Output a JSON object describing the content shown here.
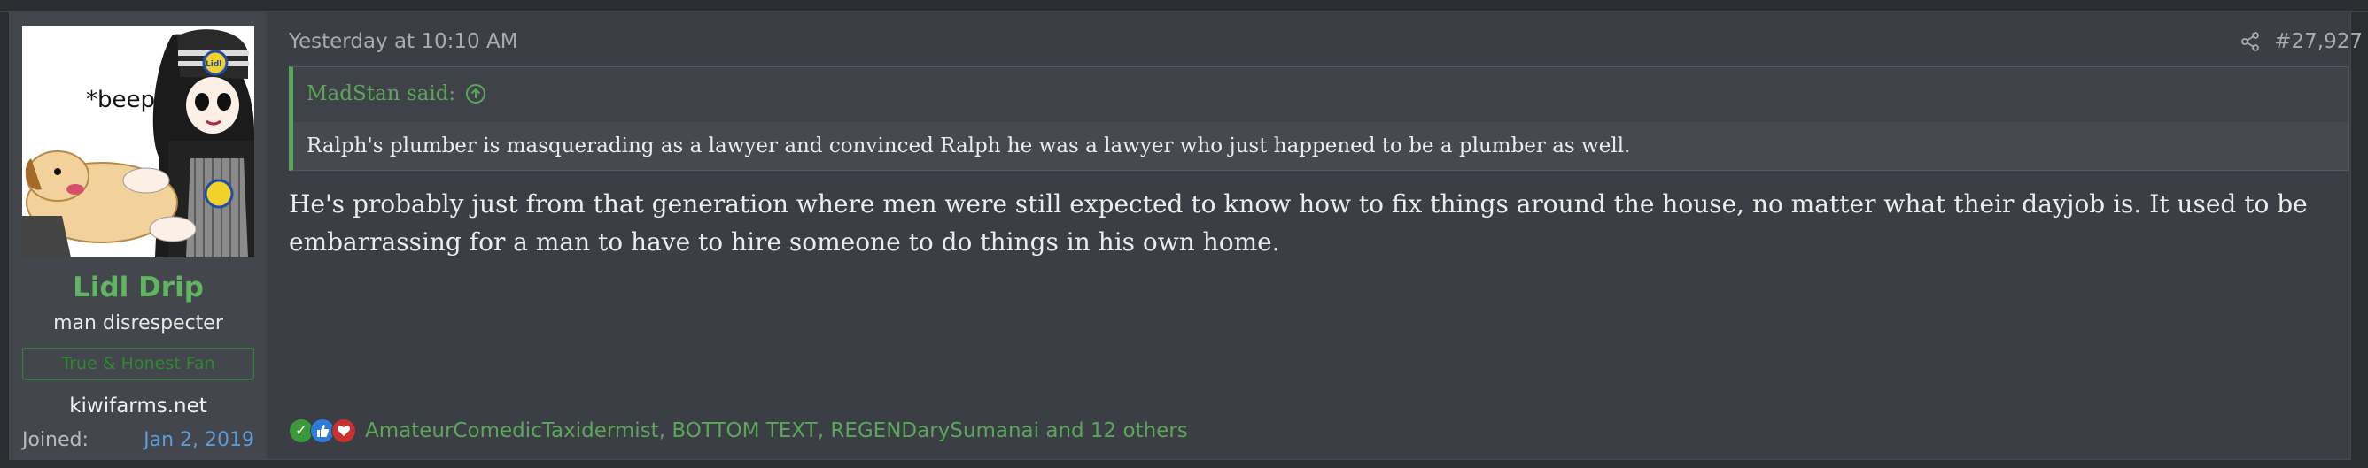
{
  "post": {
    "date": "Yesterday at 10:10 AM",
    "number": "#27,927",
    "message": "He's probably just from that generation where men were still expected to know how to fix things around the house, no matter what their dayjob is. It used to be embarrassing for a man to have to hire someone to do things in his own home."
  },
  "user": {
    "name": "Lidl Drip",
    "title": "man disrespecter",
    "banner": "True & Honest Fan",
    "site": "kiwifarms.net",
    "joined_label": "Joined:",
    "joined_date": "Jan 2, 2019",
    "avatar_caption": "*beep*",
    "avatar_logo_text": "Lidl"
  },
  "quote": {
    "author": "MadStan said:",
    "text": "Ralph's plumber is masquerading as a lawyer and convinced Ralph he was a lawyer who just happened to be a plumber as well."
  },
  "reactions": {
    "icons": [
      "check-reaction",
      "thumbs-up-reaction",
      "heart-reaction"
    ],
    "text": "AmateurComedicTaxidermist, BOTTOM TEXT, REGENDarySumanai and 12 others"
  },
  "colors": {
    "username": "#61b561",
    "link": "#5aa75a",
    "joined_date": "#5e9bd6",
    "banner": "#2e8a2e",
    "post_bg": "#3b3e44",
    "user_col_bg": "#43464c"
  }
}
